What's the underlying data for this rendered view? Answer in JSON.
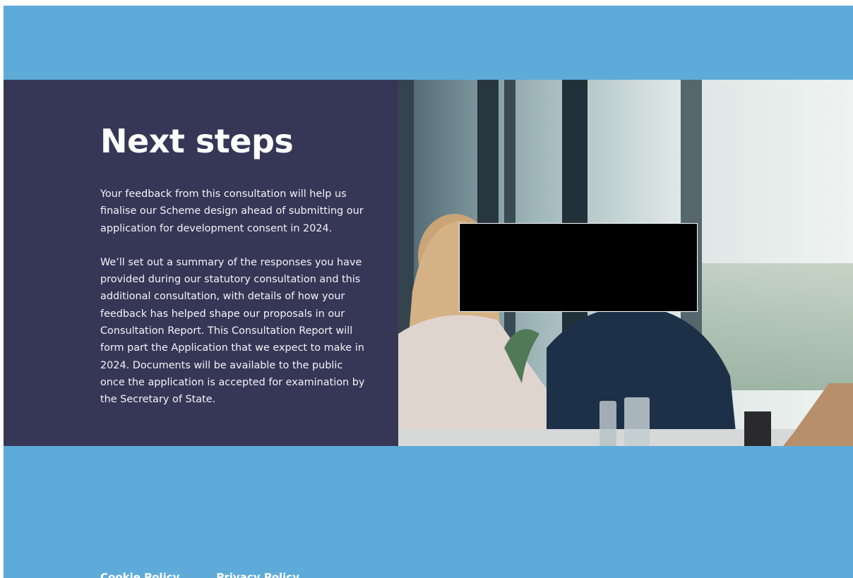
{
  "next_steps": {
    "heading": "Next steps",
    "paragraph_1": "Your feedback from this consultation will help us finalise our Scheme design ahead of submitting our application for development consent in 2024.",
    "paragraph_2": "We’ll set out a summary of the responses you have provided during our statutory consultation and this additional consultation, with details of how your feedback has helped shape our proposals in our Consultation Report. This Consultation Report will form part the Application that we expect to make in 2024. Documents will be available to the public once the application is accepted for examination by the Secretary of State."
  },
  "footer": {
    "cookie_policy": "Cookie Policy",
    "privacy_policy": "Privacy Policy"
  },
  "colors": {
    "page_background": "#5eabd9",
    "text_panel_background": "#363757",
    "text": "#ffffff"
  }
}
